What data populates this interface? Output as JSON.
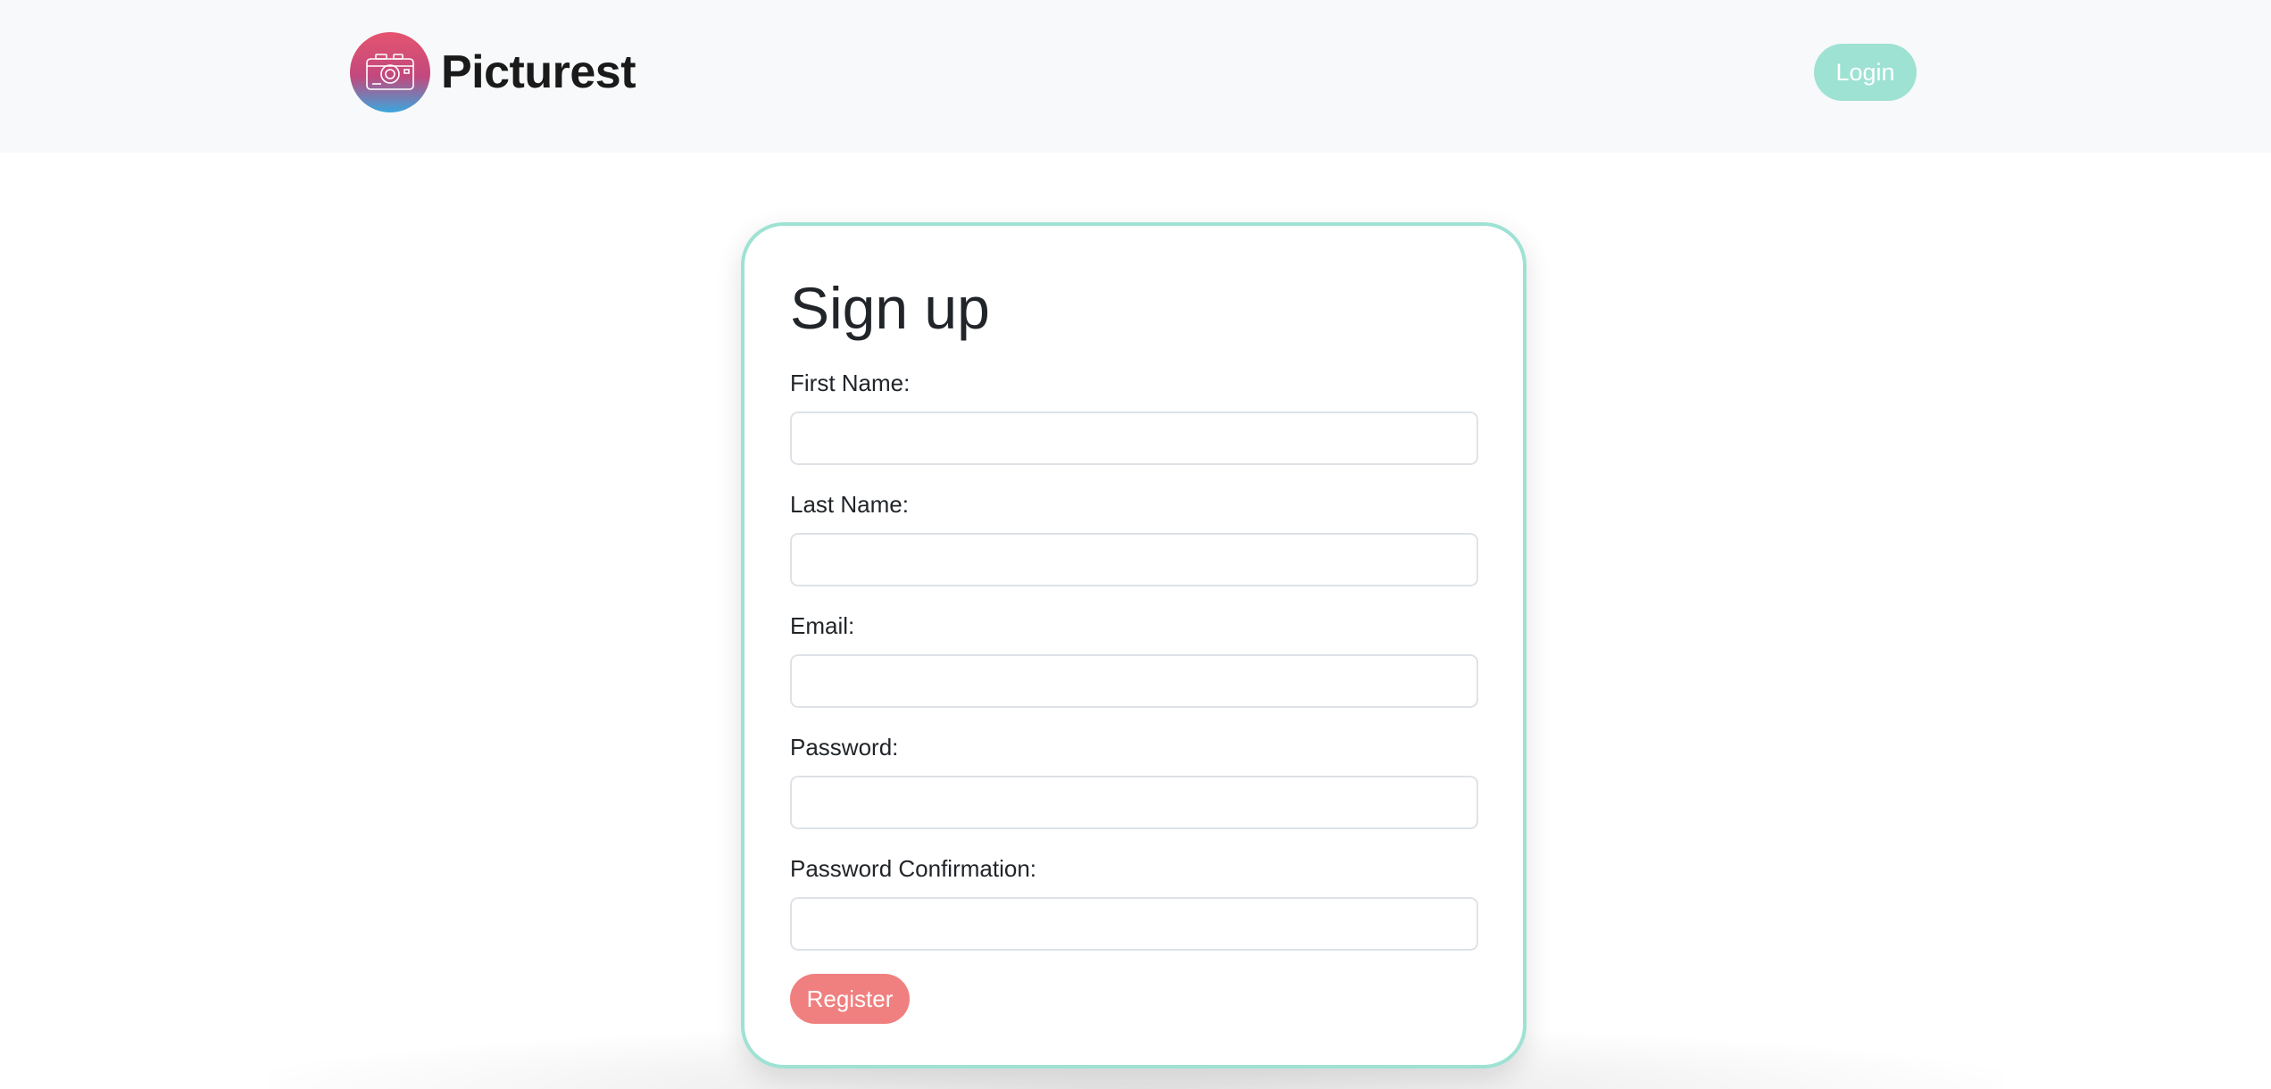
{
  "navbar": {
    "brand_name": "Picturest",
    "logo_icon": "camera-icon",
    "login_label": "Login"
  },
  "form": {
    "title": "Sign up",
    "fields": [
      {
        "label": "First Name:",
        "value": "",
        "placeholder": ""
      },
      {
        "label": "Last Name:",
        "value": "",
        "placeholder": ""
      },
      {
        "label": "Email:",
        "value": "",
        "placeholder": ""
      },
      {
        "label": "Password:",
        "value": "",
        "placeholder": ""
      },
      {
        "label": "Password Confirmation:",
        "value": "",
        "placeholder": ""
      }
    ],
    "submit_label": "Register"
  },
  "colors": {
    "navbar_bg": "#f8f9fa",
    "accent_teal": "#9ee2d4",
    "register_button": "#f08080",
    "logo_gradient_top": "#e5546f",
    "logo_gradient_bottom": "#3aa7dd"
  }
}
